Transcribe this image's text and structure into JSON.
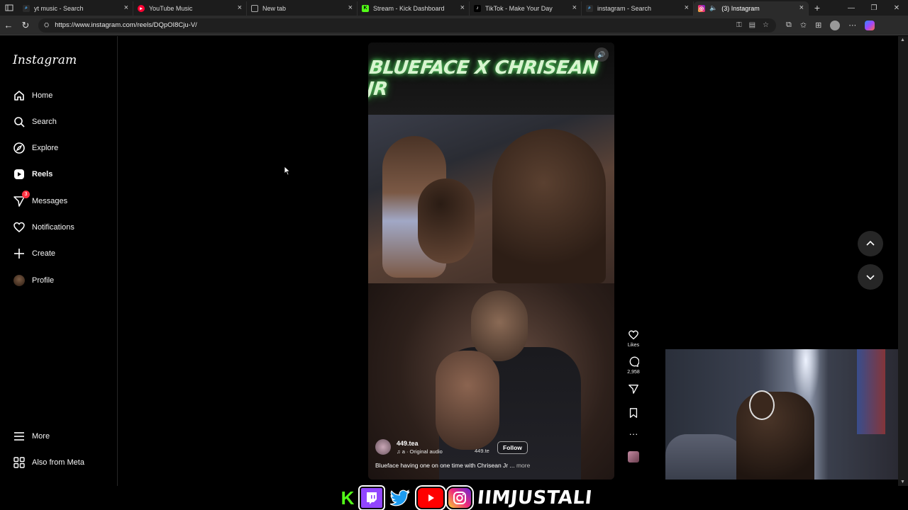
{
  "browser": {
    "tabs": [
      {
        "title": "yt music - Search",
        "favicon": "search-icon"
      },
      {
        "title": "YouTube Music",
        "favicon": "youtube-music-icon"
      },
      {
        "title": "New tab",
        "favicon": "page-icon"
      },
      {
        "title": "Stream - Kick Dashboard",
        "favicon": "kick-icon"
      },
      {
        "title": "TikTok - Make Your Day",
        "favicon": "tiktok-icon"
      },
      {
        "title": "instagram - Search",
        "favicon": "search-icon"
      },
      {
        "title": "(3) Instagram",
        "favicon": "instagram-icon",
        "active": true
      }
    ],
    "url": "https://www.instagram.com/reels/DQpOI8Cju-V/"
  },
  "instagram": {
    "logo": "Instagram",
    "nav": [
      {
        "label": "Home",
        "icon": "home-icon"
      },
      {
        "label": "Search",
        "icon": "search-icon"
      },
      {
        "label": "Explore",
        "icon": "compass-icon"
      },
      {
        "label": "Reels",
        "icon": "reels-icon",
        "active": true
      },
      {
        "label": "Messages",
        "icon": "messages-icon",
        "badge": "3"
      },
      {
        "label": "Notifications",
        "icon": "heart-icon"
      },
      {
        "label": "Create",
        "icon": "plus-icon"
      },
      {
        "label": "Profile",
        "icon": "profile-icon"
      }
    ],
    "bottom_nav": [
      {
        "label": "More",
        "icon": "menu-icon"
      },
      {
        "label": "Also from Meta",
        "icon": "meta-icon"
      }
    ],
    "reel": {
      "overlay_title": "BLUEFACE X CHRISEAN JR",
      "username": "449.tea",
      "audio": "a · Original audio",
      "audio_tag": "449.te",
      "follow_label": "Follow",
      "caption": "Blueface having one on one time with Chrisean Jr ...",
      "more_label": "more",
      "likes_label": "Likes",
      "comments_count": "2,958"
    }
  },
  "stream_overlay": {
    "handle": "IIMJUSTALI",
    "platforms": [
      "kick",
      "twitch",
      "twitter",
      "youtube",
      "instagram"
    ]
  }
}
